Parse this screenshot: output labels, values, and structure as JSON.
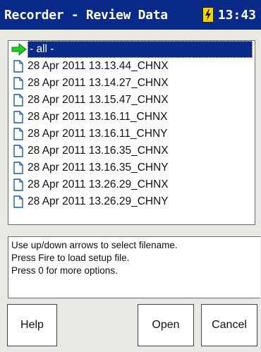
{
  "titlebar": {
    "title": "Recorder - Review Data",
    "time": "13:43"
  },
  "list": {
    "items": [
      {
        "label": "- all -",
        "icon": "green-arrow-icon",
        "selected": true
      },
      {
        "label": "28 Apr 2011 13.13.44_CHNX",
        "icon": "file-icon"
      },
      {
        "label": "28 Apr 2011 13.14.27_CHNX",
        "icon": "file-icon"
      },
      {
        "label": "28 Apr 2011 13.15.47_CHNX",
        "icon": "file-icon"
      },
      {
        "label": "28 Apr 2011 13.16.11_CHNX",
        "icon": "file-icon"
      },
      {
        "label": "28 Apr 2011 13.16.11_CHNY",
        "icon": "file-icon"
      },
      {
        "label": "28 Apr 2011 13.16.35_CHNX",
        "icon": "file-icon"
      },
      {
        "label": "28 Apr 2011 13.16.35_CHNY",
        "icon": "file-icon"
      },
      {
        "label": "28 Apr 2011 13.26.29_CHNX",
        "icon": "file-icon"
      },
      {
        "label": "28 Apr 2011 13.26.29_CHNY",
        "icon": "file-icon"
      }
    ]
  },
  "info": {
    "lines": [
      "Use up/down arrows to select filename.",
      "Press Fire to load setup file.",
      "Press 0 for more options."
    ]
  },
  "buttons": {
    "help": "Help",
    "open": "Open",
    "cancel": "Cancel"
  },
  "colors": {
    "titlebar": "#0a2a8a",
    "selection": "#0a2a8a",
    "arrow": "#22cc22",
    "battery": "#f5d400"
  }
}
